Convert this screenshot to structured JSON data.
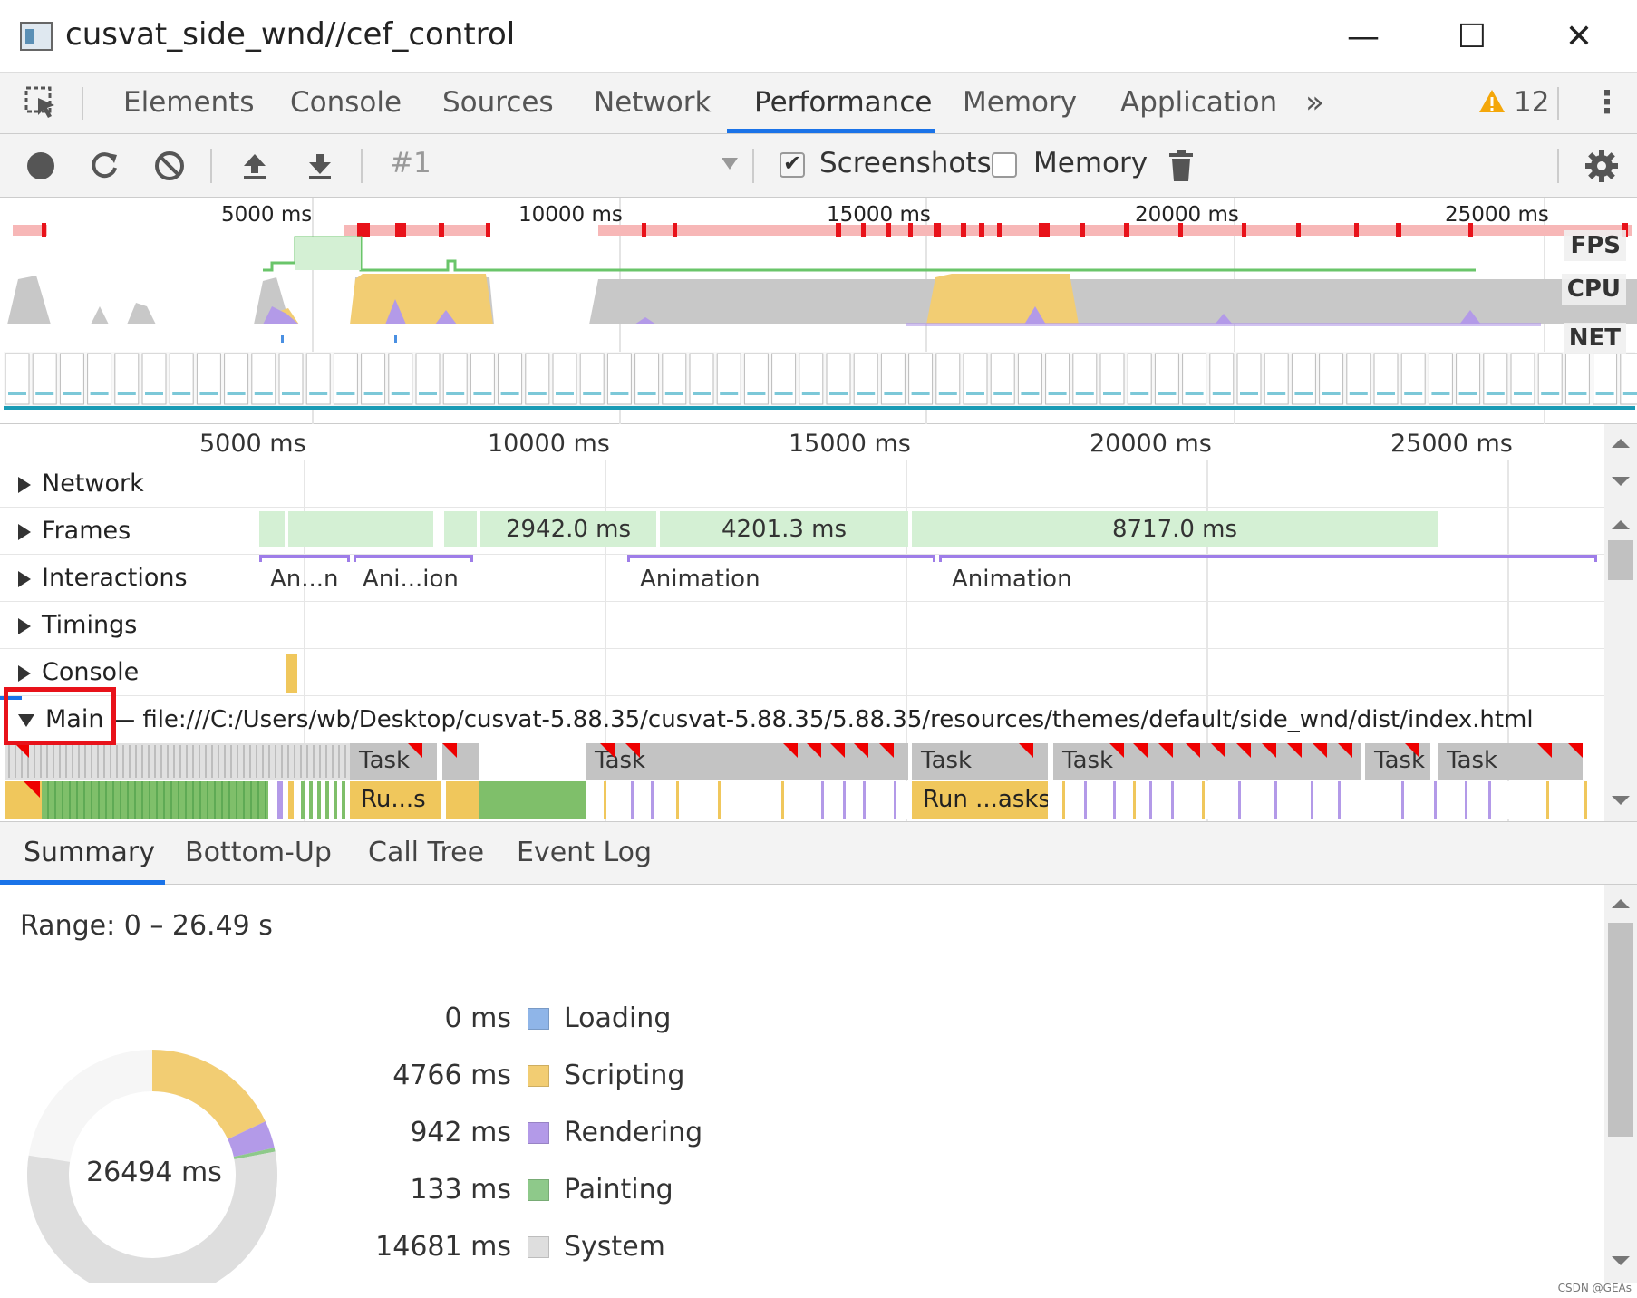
{
  "window": {
    "title": "cusvat_side_wnd//cef_control",
    "minimize": "—",
    "maximize": "☐",
    "close": "✕"
  },
  "devtools_tabs": {
    "items": [
      "Elements",
      "Console",
      "Sources",
      "Network",
      "Performance",
      "Memory",
      "Application"
    ],
    "active": "Performance",
    "more": "»",
    "warning_count": "12",
    "menu": "⋮"
  },
  "toolbar": {
    "profile_select": "#1",
    "screenshots_label": "Screenshots",
    "screenshots_checked": true,
    "memory_label": "Memory",
    "memory_checked": false
  },
  "overview": {
    "ticks": [
      "5000 ms",
      "10000 ms",
      "15000 ms",
      "20000 ms",
      "25000 ms"
    ],
    "lanes": [
      "FPS",
      "CPU",
      "NET"
    ]
  },
  "flame": {
    "ticks": [
      "5000 ms",
      "10000 ms",
      "15000 ms",
      "20000 ms",
      "25000 ms"
    ],
    "tracks": {
      "network": "Network",
      "frames": "Frames",
      "interactions": "Interactions",
      "timings": "Timings",
      "console": "Console",
      "main": "Main",
      "main_url": "— file:///C:/Users/wb/Desktop/cusvat-5.88.35/cusvat-5.88.35/5.88.35/resources/themes/default/side_wnd/dist/index.html"
    },
    "frame_durations": [
      "2942.0 ms",
      "4201.3 ms",
      "8717.0 ms"
    ],
    "interactions": [
      "An...n",
      "Ani...ion",
      "Animation",
      "Animation"
    ],
    "tasks": [
      "Task",
      "Task",
      "Task",
      "Task",
      "Task",
      "Task"
    ],
    "scripts": [
      "Ru...s",
      "Run ...asks"
    ]
  },
  "bottom_tabs": {
    "items": [
      "Summary",
      "Bottom-Up",
      "Call Tree",
      "Event Log"
    ],
    "active": "Summary"
  },
  "summary": {
    "range": "Range: 0 – 26.49 s",
    "total": "26494 ms",
    "categories": [
      {
        "value": "0 ms",
        "name": "Loading",
        "ms": 0,
        "color": "#8fb5e8"
      },
      {
        "value": "4766 ms",
        "name": "Scripting",
        "ms": 4766,
        "color": "#f2cd73"
      },
      {
        "value": "942 ms",
        "name": "Rendering",
        "ms": 942,
        "color": "#b39ae8"
      },
      {
        "value": "133 ms",
        "name": "Painting",
        "ms": 133,
        "color": "#8ec98a"
      },
      {
        "value": "14681 ms",
        "name": "System",
        "ms": 14681,
        "color": "#dedede"
      }
    ]
  },
  "watermark": "CSDN @GEAs"
}
